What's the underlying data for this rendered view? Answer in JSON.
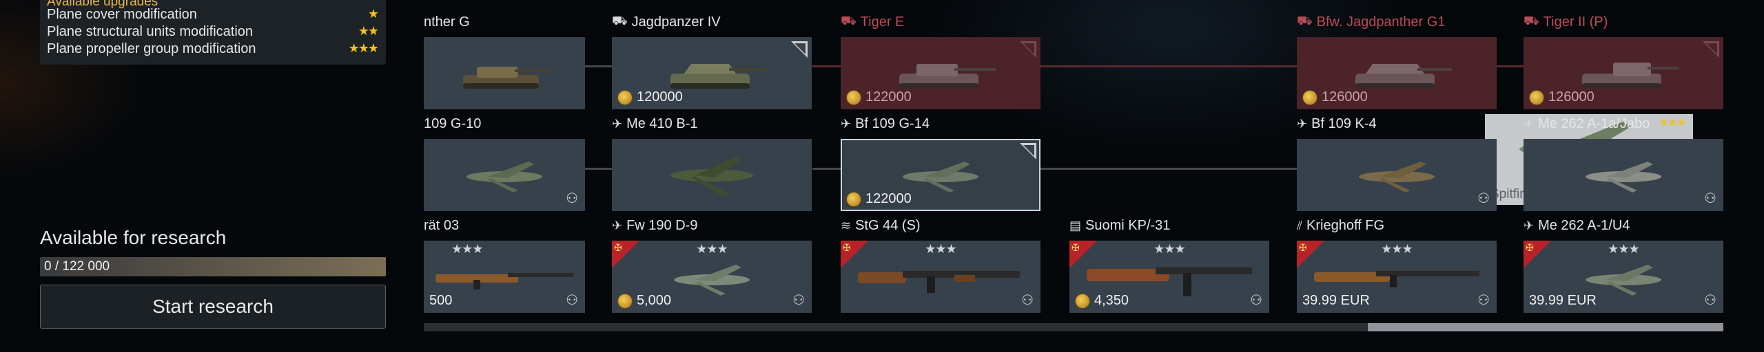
{
  "upgrades": {
    "header": "Available upgrades",
    "items": [
      {
        "label": "Plane cover modification",
        "stars": "★"
      },
      {
        "label": "Plane structural units modification",
        "stars": "★★"
      },
      {
        "label": "Plane propeller group modification",
        "stars": "★★★"
      }
    ]
  },
  "research": {
    "title": "Available for research",
    "progress_text": "0 / 122 000",
    "progress_value": 0,
    "button_label": "Start research"
  },
  "tree": {
    "row1": [
      {
        "name": "nther G",
        "icon": "tank-icon",
        "price": "",
        "locked": false
      },
      {
        "name": "Jagdpanzer IV",
        "icon": "tank-icon",
        "price": "120000",
        "locked": false
      },
      {
        "name": "Tiger E",
        "icon": "tank-icon",
        "price": "122000",
        "locked": true
      },
      {
        "name": "Bfw. Jagdpanther G1",
        "icon": "tank-icon",
        "price": "126000",
        "locked": true
      },
      {
        "name": "Tiger II (P)",
        "icon": "tank-icon",
        "price": "126000",
        "locked": true
      }
    ],
    "row2": [
      {
        "name": "109 G-10",
        "icon": "plane-icon",
        "price": ""
      },
      {
        "name": "Me 410 B-1",
        "icon": "plane-icon",
        "price": ""
      },
      {
        "name": "Bf 109 G-14",
        "icon": "plane-icon",
        "price": "122000",
        "selected": true
      },
      {
        "name": "Bf 109 K-4",
        "icon": "plane-icon",
        "price": ""
      },
      {
        "name": "Me 262 A-1a/Jabo",
        "icon": "plane-icon",
        "price": ""
      }
    ],
    "spitfire": {
      "name": "Spitfire LF Mk IX",
      "stars": "★★★",
      "br": "★★★ ★"
    },
    "row3": [
      {
        "name": "rät 03",
        "icon": "rifle-icon",
        "stars": "★★★",
        "price": "500"
      },
      {
        "name": "Fw 190 D-9",
        "icon": "plane-icon",
        "stars": "★★★",
        "price": "5,000"
      },
      {
        "name": "StG 44 (S)",
        "icon": "rifle-icon",
        "stars": "★★★",
        "price": ""
      },
      {
        "name": "Suomi KP/-31",
        "icon": "smg-icon",
        "stars": "★★★",
        "price": "4,350"
      },
      {
        "name": "Krieghoff FG",
        "icon": "rifle-icon",
        "stars": "★★★",
        "price": "39.99 EUR"
      },
      {
        "name": "Me 262 A-1/U4",
        "icon": "plane-icon",
        "stars": "★★★",
        "price": "39.99 EUR"
      }
    ]
  },
  "colors": {
    "accent_gold": "#e8b446",
    "locked_red": "#b84d56",
    "card_bg": "#37414b"
  }
}
